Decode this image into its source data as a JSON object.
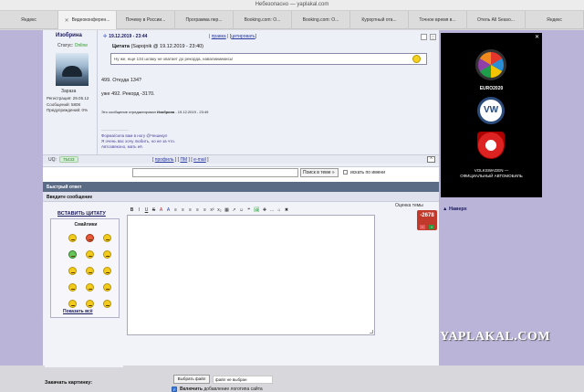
{
  "browser": {
    "title": "Небезопасно — yaplakal.com",
    "tabs": [
      {
        "label": "Яндекс",
        "active": false
      },
      {
        "label": "Видеоконферен...",
        "active": true
      },
      {
        "label": "Почему в России...",
        "active": false
      },
      {
        "label": "Программа пер...",
        "active": false
      },
      {
        "label": "Booking.com: О...",
        "active": false
      },
      {
        "label": "Booking.com: O...",
        "active": false
      },
      {
        "label": "Курортный ота...",
        "active": false
      },
      {
        "label": "Точное время в...",
        "active": false
      },
      {
        "label": "Отель All Seaso...",
        "active": false
      },
      {
        "label": "Яндекс",
        "active": false
      }
    ]
  },
  "post": {
    "author": "Изобрина",
    "status_label": "Статус:",
    "status_value": "Online",
    "avatar_caption": "Зараза",
    "registration": "Регистрация: 29.05.12",
    "messages": "Сообщений: 5808",
    "warnings": "Предупреждений: 0%",
    "date": "19.12.2019 - 23:44",
    "link_edit": "правка",
    "link_quote": "цитировать",
    "quote_header_label": "Цитата",
    "quote_header_meta": "(Sapojnik @ 19.12.2019 - 23:40)",
    "quote_text": "Ну же, еще 134 шлаку не хватает до рекорда, навалиииииись!",
    "text_line1": "499. Откуда 134?",
    "text_line2": "уже 492. Рекорд -3170.",
    "edited_prefix": "Это сообщение отредактировал",
    "edited_author": "Изобрина",
    "edited_date": "- 19.12.2019 - 23:49",
    "sig_dash": "--------------------",
    "sig_line1": "Форма/сила вам в ногу @Чешикул",
    "sig_line2": "Я очень вас хочу любить, но не за что.",
    "sig_line3": "Автозвяконо, мать её."
  },
  "footer": {
    "uq_label": "UQ:",
    "uq_value": "75433",
    "link_profile": "профиль",
    "link_pm": "ПМ",
    "link_email": "e-mail",
    "top_arrow": "^"
  },
  "search": {
    "button": "Поиск в теме »",
    "check_label": "искать по имени"
  },
  "quick_reply": {
    "header": "Быстрый ответ",
    "subheader": "Введите сообщение",
    "insert_quote": "ВСТАВИТЬ ЦИТАТУ",
    "smileys_title": "Смайлики",
    "show_all": "Показать всё",
    "toolbar": [
      "B",
      "I",
      "U",
      "S",
      "A",
      "A",
      "≡",
      "≡",
      "≡",
      "≡",
      "≡",
      "x²",
      "x₂",
      "▦",
      "↗",
      "☺",
      "❝",
      "🖼",
      "✚",
      "…",
      "⌂",
      "✖"
    ],
    "theme_rating_label": "Оценка темы",
    "theme_rating_value": "-2678",
    "upload_label": "Закачать картинку:",
    "file_button": "Выбрать файл",
    "file_status": "файл не выбран",
    "logo_label_bold": "Включить",
    "logo_label_rest": "добавление логотипа сайта"
  },
  "sidebar": {
    "ad_title": "EURO2020",
    "ad_text_line1": "VOLKSWAGEN —",
    "ad_text_line2": "ОФИЦИАЛЬНЫЙ АВТОМОБИЛЬ",
    "go_top": "Наверх"
  },
  "watermark": "YAPLAKAL.COM",
  "colors": {
    "page_bg": "#b9b4d8",
    "header_bar": "#5a6b86",
    "link": "#2a3aa0",
    "online": "#2a9a2a",
    "rating": "#c0392b"
  }
}
